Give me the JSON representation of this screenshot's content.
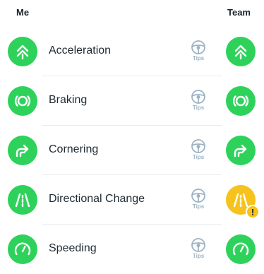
{
  "header": {
    "me_label": "Me",
    "team_label": "Team"
  },
  "colors": {
    "good": "#2ed25b",
    "warning": "#f6c21c",
    "tips_icon": "#9db3c4"
  },
  "rows": [
    {
      "label": "Acceleration",
      "icon": "acceleration-icon",
      "tips_label": "Tips",
      "me_status": "good",
      "team_status": "good"
    },
    {
      "label": "Braking",
      "icon": "braking-icon",
      "tips_label": "Tips",
      "me_status": "good",
      "team_status": "good"
    },
    {
      "label": "Cornering",
      "icon": "cornering-icon",
      "tips_label": "Tips",
      "me_status": "good",
      "team_status": "good"
    },
    {
      "label": "Directional Change",
      "icon": "directional-change-icon",
      "tips_label": "Tips",
      "me_status": "good",
      "team_status": "warning",
      "team_badge": "!"
    },
    {
      "label": "Speeding",
      "icon": "speedometer-icon",
      "tips_label": "Tips",
      "me_status": "good",
      "team_status": "good"
    }
  ]
}
